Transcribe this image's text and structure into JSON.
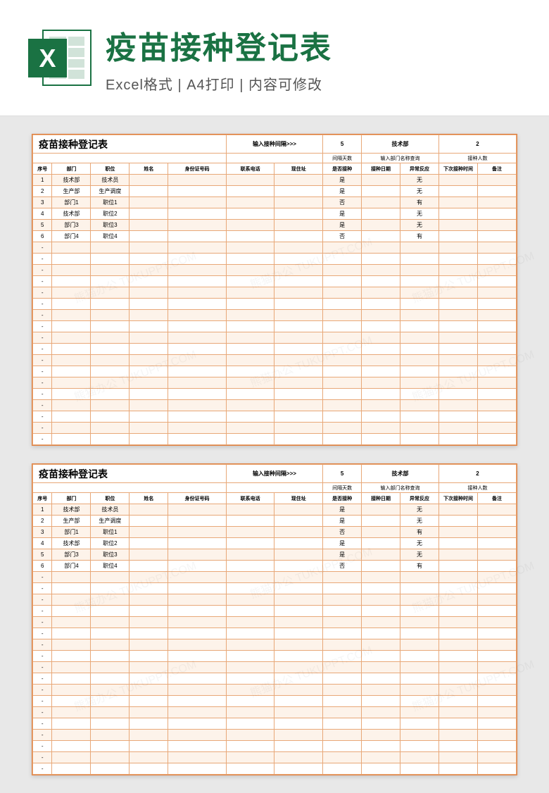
{
  "banner": {
    "title": "疫苗接种登记表",
    "subtitle": "Excel格式 | A4打印 | 内容可修改",
    "icon_letter": "X"
  },
  "sheet": {
    "title": "疫苗接种登记表",
    "top_labels": {
      "input_interval": "输入接种间隔>>>",
      "interval_value": "5",
      "dept_query": "技术部",
      "count_value": "2",
      "interval_days": "间隔天数",
      "dept_query_label": "输入部门名称查询",
      "count_label": "接种人数"
    },
    "columns": [
      "序号",
      "部门",
      "职位",
      "姓名",
      "身份证号码",
      "联系电话",
      "现住址",
      "是否接种",
      "接种日期",
      "异常反应",
      "下次接种时间",
      "备注"
    ],
    "rows": [
      {
        "seq": "1",
        "dept": "技术部",
        "pos": "技术员",
        "name": "",
        "id": "",
        "phone": "",
        "addr": "",
        "vac": "是",
        "date": "",
        "react": "无",
        "next": "",
        "note": ""
      },
      {
        "seq": "2",
        "dept": "生产部",
        "pos": "生产调度",
        "name": "",
        "id": "",
        "phone": "",
        "addr": "",
        "vac": "是",
        "date": "",
        "react": "无",
        "next": "",
        "note": ""
      },
      {
        "seq": "3",
        "dept": "部门1",
        "pos": "职位1",
        "name": "",
        "id": "",
        "phone": "",
        "addr": "",
        "vac": "否",
        "date": "",
        "react": "有",
        "next": "",
        "note": ""
      },
      {
        "seq": "4",
        "dept": "技术部",
        "pos": "职位2",
        "name": "",
        "id": "",
        "phone": "",
        "addr": "",
        "vac": "是",
        "date": "",
        "react": "无",
        "next": "",
        "note": ""
      },
      {
        "seq": "5",
        "dept": "部门3",
        "pos": "职位3",
        "name": "",
        "id": "",
        "phone": "",
        "addr": "",
        "vac": "是",
        "date": "",
        "react": "无",
        "next": "",
        "note": ""
      },
      {
        "seq": "6",
        "dept": "部门4",
        "pos": "职位4",
        "name": "",
        "id": "",
        "phone": "",
        "addr": "",
        "vac": "否",
        "date": "",
        "react": "有",
        "next": "",
        "note": ""
      }
    ],
    "empty_rows": 18,
    "empty_seq": "-"
  },
  "watermark": "熊猫办公 TUKUPPT.COM"
}
